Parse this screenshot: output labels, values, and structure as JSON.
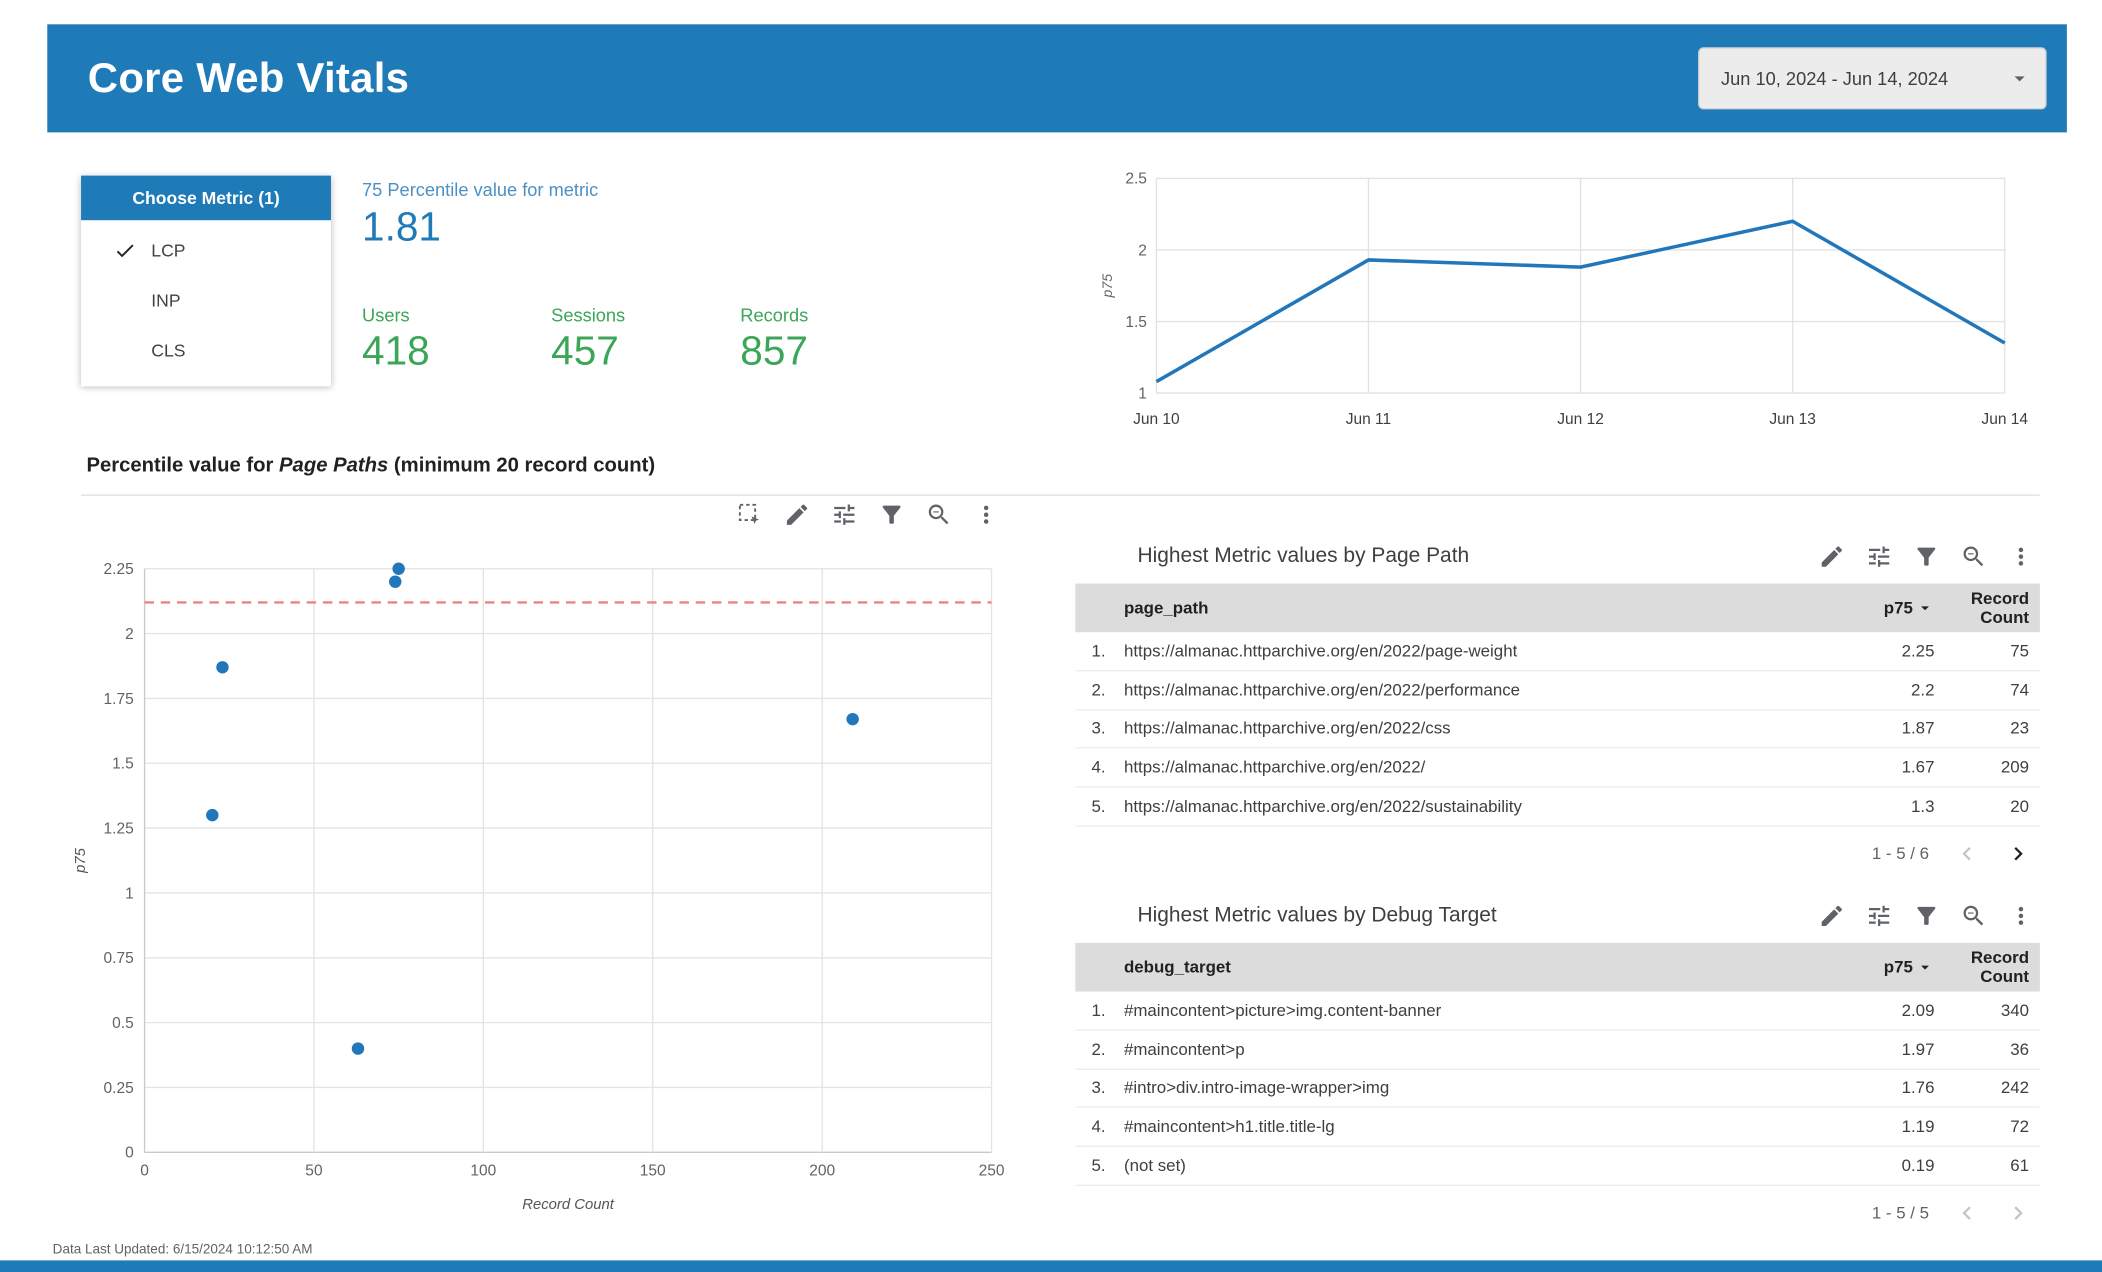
{
  "colors": {
    "brand_blue": "#1f7ab8",
    "label_blue": "#4d90c4",
    "green": "#3ba558",
    "ref_red": "#ee8282",
    "point_blue": "#2277bb",
    "header_gray": "#dcdcdc"
  },
  "header": {
    "title": "Core Web Vitals",
    "date_range": "Jun 10, 2024 - Jun 14, 2024"
  },
  "metric_selector": {
    "title": "Choose Metric (1)",
    "options": [
      {
        "label": "LCP",
        "selected": true
      },
      {
        "label": "INP",
        "selected": false
      },
      {
        "label": "CLS",
        "selected": false
      }
    ]
  },
  "scorecards": {
    "percentile_label": "75 Percentile value for metric",
    "percentile_value": "1.81",
    "kpis": [
      {
        "label": "Users",
        "value": "418"
      },
      {
        "label": "Sessions",
        "value": "457"
      },
      {
        "label": "Records",
        "value": "857"
      }
    ]
  },
  "section": {
    "title_prefix": "Percentile value for ",
    "title_italic": "Page Paths",
    "title_suffix": " (minimum 20 record count)"
  },
  "chart_data": [
    {
      "type": "line",
      "x": [
        "Jun 10",
        "Jun 11",
        "Jun 12",
        "Jun 13",
        "Jun 14"
      ],
      "values": [
        1.08,
        1.93,
        1.88,
        2.2,
        1.35
      ],
      "ylabel": "p75",
      "ylim": [
        1,
        2.5
      ],
      "yticks": [
        1,
        1.5,
        2,
        2.5
      ],
      "grid": true,
      "legend": false
    },
    {
      "type": "scatter",
      "xlabel": "Record Count",
      "ylabel": "p75",
      "xlim": [
        0,
        250
      ],
      "xticks": [
        0,
        50,
        100,
        150,
        200,
        250
      ],
      "ylim": [
        0,
        2.25
      ],
      "yticks": [
        0,
        0.25,
        0.5,
        0.75,
        1,
        1.25,
        1.5,
        1.75,
        2,
        2.25
      ],
      "points": [
        [
          20,
          1.3
        ],
        [
          23,
          1.87
        ],
        [
          63,
          0.4
        ],
        [
          74,
          2.2
        ],
        [
          75,
          2.25
        ],
        [
          209,
          1.67
        ]
      ],
      "reference_line_y": 2.12,
      "grid": true
    }
  ],
  "tables": [
    {
      "title": "Highest Metric values by Page Path",
      "dim_header": "page_path",
      "metric_header": "p75",
      "count_header": "Record Count",
      "rows": [
        {
          "index": "1.",
          "name": "https://almanac.httparchive.org/en/2022/page-weight",
          "p75": "2.25",
          "count": "75"
        },
        {
          "index": "2.",
          "name": "https://almanac.httparchive.org/en/2022/performance",
          "p75": "2.2",
          "count": "74"
        },
        {
          "index": "3.",
          "name": "https://almanac.httparchive.org/en/2022/css",
          "p75": "1.87",
          "count": "23"
        },
        {
          "index": "4.",
          "name": "https://almanac.httparchive.org/en/2022/",
          "p75": "1.67",
          "count": "209"
        },
        {
          "index": "5.",
          "name": "https://almanac.httparchive.org/en/2022/sustainability",
          "p75": "1.3",
          "count": "20"
        }
      ],
      "pagination": "1 - 5 / 6",
      "prev_enabled": false,
      "next_enabled": true
    },
    {
      "title": "Highest Metric values by Debug Target",
      "dim_header": "debug_target",
      "metric_header": "p75",
      "count_header": "Record Count",
      "rows": [
        {
          "index": "1.",
          "name": "#maincontent>picture>img.content-banner",
          "p75": "2.09",
          "count": "340"
        },
        {
          "index": "2.",
          "name": "#maincontent>p",
          "p75": "1.97",
          "count": "36"
        },
        {
          "index": "3.",
          "name": "#intro>div.intro-image-wrapper>img",
          "p75": "1.76",
          "count": "242"
        },
        {
          "index": "4.",
          "name": "#maincontent>h1.title.title-lg",
          "p75": "1.19",
          "count": "72"
        },
        {
          "index": "5.",
          "name": "(not set)",
          "p75": "0.19",
          "count": "61"
        }
      ],
      "pagination": "1 - 5 / 5",
      "prev_enabled": false,
      "next_enabled": false
    }
  ],
  "footer": {
    "last_updated": "Data Last Updated: 6/15/2024 10:12:50 AM"
  },
  "icons": {
    "select": "marquee-selection",
    "pencil": "edit-pencil",
    "sliders": "tune-sliders",
    "funnel": "filter-funnel",
    "zoom": "magnifier-zoom-out",
    "kebab": "three-dot-menu",
    "check": "checkmark",
    "caret": "triangle-down",
    "chevleft": "chevron-left",
    "chevright": "chevron-right"
  }
}
